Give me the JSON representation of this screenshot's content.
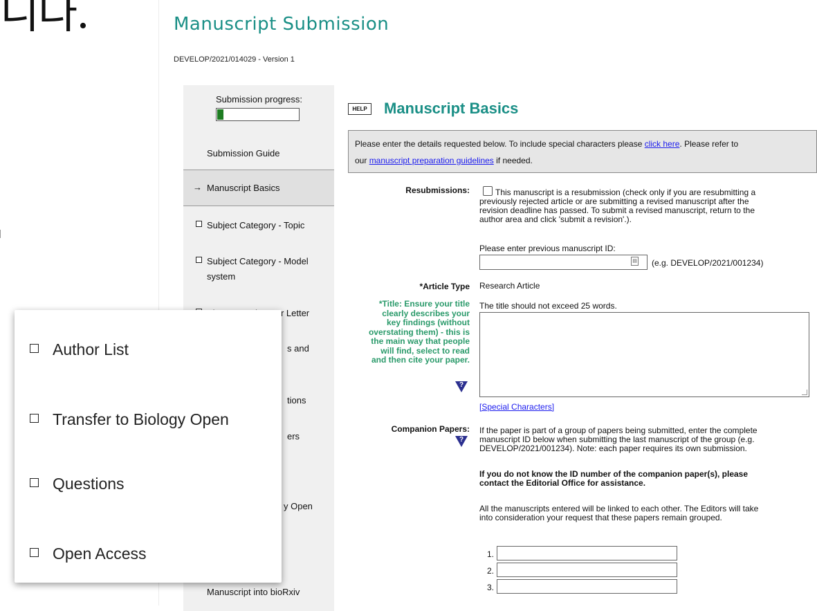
{
  "handwriting": "니다.",
  "page": {
    "title": "Manuscript Submission",
    "manuscript_id": "DEVELOP/2021/014029 - Version 1"
  },
  "progress": {
    "label": "Submission progress:",
    "fraction": 0.08,
    "color": "#1e7d22"
  },
  "nav": {
    "items": [
      {
        "label": "Submission Guide",
        "state": "none"
      },
      {
        "label": "Manuscript Basics",
        "state": "current",
        "marker": "→"
      },
      {
        "label": "Subject Category - Topic",
        "state": "todo"
      },
      {
        "label": "Subject Category - Model",
        "label2": "system",
        "state": "todo"
      },
      {
        "label": "Abstract and Cover Letter",
        "state": "todo"
      },
      {
        "label": "s and",
        "state": "partial"
      },
      {
        "label": "tions",
        "state": "partial"
      },
      {
        "label": "ers",
        "state": "partial"
      },
      {
        "label": "y Open",
        "state": "partial"
      },
      {
        "label": "Manuscript into bioRxiv",
        "state": "partial"
      }
    ]
  },
  "section": {
    "help_label": "HELP",
    "title": "Manuscript Basics",
    "info_part1": "Please enter the details requested below. To include special characters please ",
    "info_link1": "click here",
    "info_part2": ". Please refer to",
    "info_part3": "our ",
    "info_link2": "manuscript preparation guidelines",
    "info_part4": " if needed."
  },
  "resubmissions": {
    "label": "Resubmissions:",
    "checkbox_text_lines": [
      "This manuscript is a resubmission (check only if you are resubmitting a",
      "previously rejected article or are submitting a revised manuscript after the",
      "revision deadline has passed. To submit a revised manuscript, return to the",
      "author area and click 'submit a revision'.)."
    ],
    "checked": false,
    "prev_id_label": "Please enter previous manuscript ID:",
    "prev_id_value": "",
    "prev_id_example": "(e.g. DEVELOP/2021/001234)"
  },
  "article_type": {
    "label": "*Article Type",
    "value": "Research Article"
  },
  "title_field": {
    "help_lines": [
      "*Title: Ensure your title",
      "clearly describes your",
      "key findings (without",
      "overstating them) - this is",
      "the main way that people",
      "will find, select to read",
      "and then cite your paper."
    ],
    "instruction": "The title should not exceed 25 words.",
    "value": "",
    "special_chars_link": "[Special Characters]"
  },
  "companion": {
    "label": "Companion Papers:",
    "desc_lines": [
      "If the paper is part of a group of papers being submitted, enter the complete",
      "manuscript ID below when submitting the last manuscript of the group (e.g.",
      "DEVELOP/2021/001234). Note: each paper requires its own submission."
    ],
    "bold_lines": [
      "If you do not know the ID number of the companion paper(s), please",
      "contact the Editorial Office for assistance."
    ],
    "note_lines": [
      "All the manuscripts entered will be linked to each other. The Editors will take",
      "into consideration your request that these papers remain grouped."
    ],
    "entries": [
      {
        "num": "1.",
        "value": ""
      },
      {
        "num": "2.",
        "value": ""
      },
      {
        "num": "3.",
        "value": ""
      }
    ]
  },
  "question_mark": "?",
  "zoom_overlay": {
    "items": [
      {
        "label": "Author List"
      },
      {
        "label": "Transfer to Biology Open"
      },
      {
        "label": "Questions"
      },
      {
        "label": "Open Access"
      }
    ]
  }
}
